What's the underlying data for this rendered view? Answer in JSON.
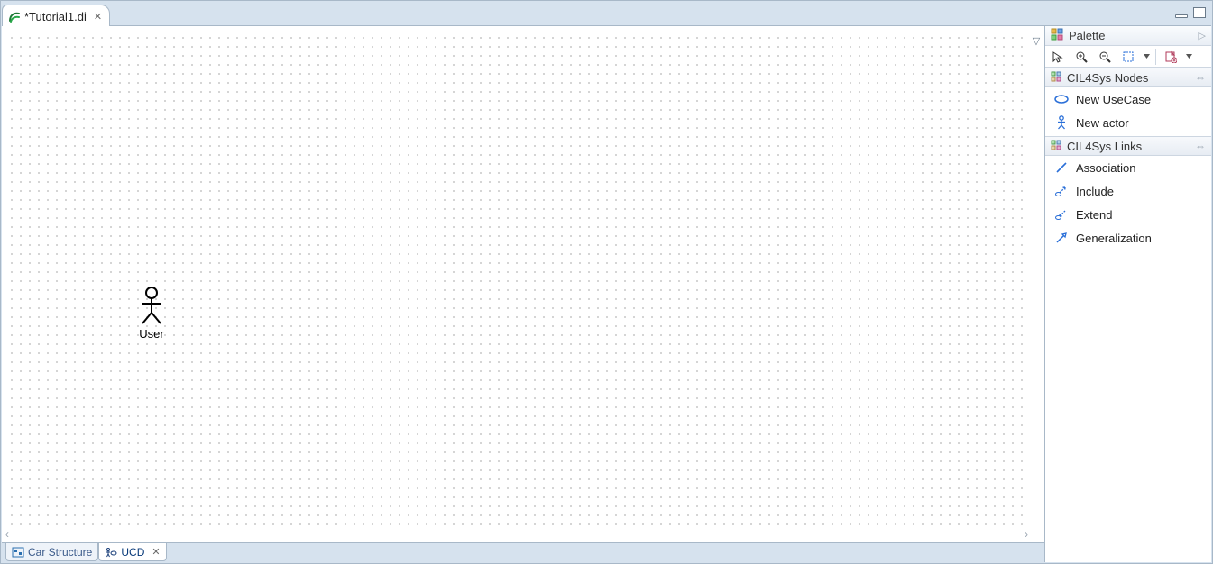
{
  "editor": {
    "tab_title": "*Tutorial1.di",
    "actor_label": "User"
  },
  "inner_tabs": {
    "items": [
      {
        "label": "Car Structure",
        "active": false
      },
      {
        "label": "UCD",
        "active": true
      }
    ]
  },
  "palette": {
    "title": "Palette",
    "toolbar_icons": [
      "pointer",
      "zoom-in",
      "zoom-out",
      "marquee",
      "dropdown-caret",
      "note",
      "dropdown-caret"
    ],
    "drawers": [
      {
        "title": "CIL4Sys Nodes",
        "items": [
          {
            "label": "New UseCase",
            "icon": "usecase-icon"
          },
          {
            "label": "New actor",
            "icon": "actor-icon"
          }
        ]
      },
      {
        "title": "CIL4Sys Links",
        "items": [
          {
            "label": "Association",
            "icon": "association-icon"
          },
          {
            "label": "Include",
            "icon": "include-icon"
          },
          {
            "label": "Extend",
            "icon": "extend-icon"
          },
          {
            "label": "Generalization",
            "icon": "generalization-icon"
          }
        ]
      }
    ]
  }
}
